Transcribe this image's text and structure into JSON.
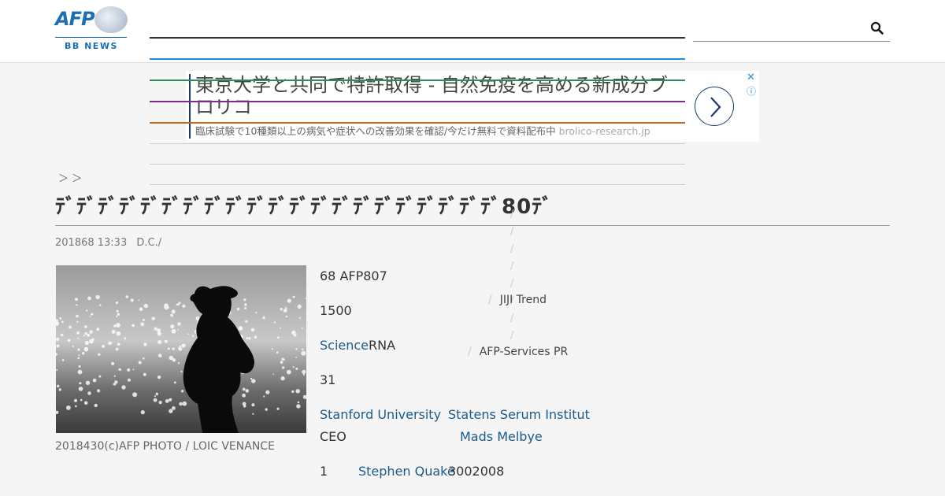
{
  "header": {
    "logo_text": "AFP",
    "logo_sub": "BB NEWS"
  },
  "colors": {
    "brand": "#1c6fb4",
    "link": "#1c5a8c",
    "nav_lines": [
      "#333333",
      "#1c8fd6",
      "#2e8b57",
      "#7b2d8b",
      "#c96a1a",
      "#cccccc",
      "#cccccc"
    ]
  },
  "ad": {
    "title": "東京大学と共同で特許取得 - 自然免疫を高める新成分ブロリコ",
    "description": "臨床試験で10種類以上の病気や症状への改善効果を確認/今だけ無料で資料配布中",
    "domain": "brolico-research.jp",
    "close": "✕",
    "info": "ⓘ"
  },
  "breadcrumb": "＞ ＞",
  "article": {
    "title": "ﾃﾞﾃﾞﾃﾞﾃﾞﾃﾞﾃﾞﾃﾞﾃﾞﾃﾞﾃﾞﾃﾞﾃﾞﾃﾞﾃﾞﾃﾞﾃﾞﾃﾞﾃﾞﾃﾞﾃﾞﾃﾞ80ﾃﾞ",
    "date": "201868 13:33",
    "source": "D.C./",
    "caption": "2018430(c)AFP PHOTO / LOIC VENANCE",
    "p1": "68 AFP807",
    "p2": "1500",
    "p3_link": "Science",
    "p3_text": "RNA",
    "p4": "31",
    "link_stanford": "Stanford University",
    "link_statens": "Statens Serum Institut",
    "ceo": "CEO",
    "link_melbye": "Mads Melbye",
    "p7_num": "1",
    "link_quake": "Stephen Quake",
    "p7_text": "3002008"
  },
  "sidebar": {
    "slashes": [
      "/",
      "/",
      "/",
      "/",
      "/",
      "/",
      "/",
      "/"
    ],
    "jiji": "JIJI Trend",
    "afp_services": "AFP-Services PR",
    "sep": "/"
  }
}
